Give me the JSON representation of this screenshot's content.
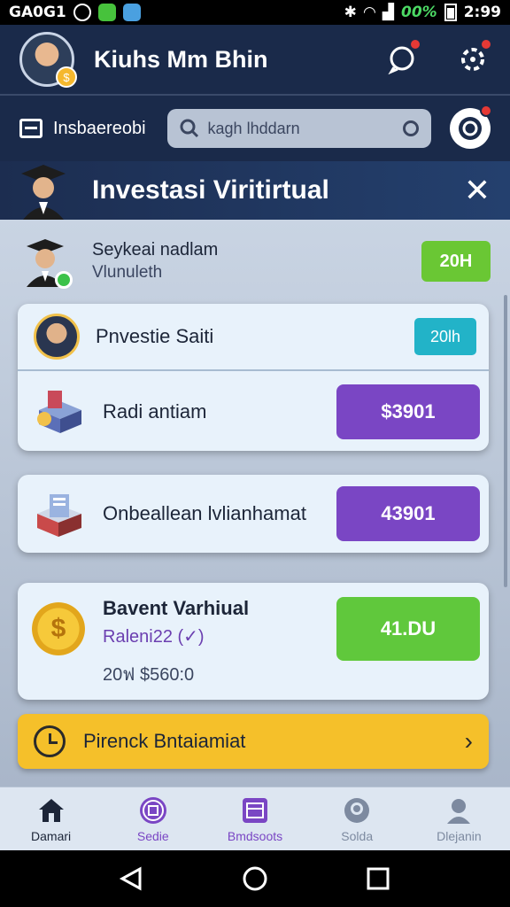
{
  "status_bar": {
    "carrier": "GA0G1",
    "battery": "00%",
    "time": "2:99"
  },
  "header": {
    "user_name": "Kiuhs Mm Bhin",
    "avatar_badge": "$"
  },
  "search_row": {
    "menu_label": "Insbaereobi",
    "search_placeholder": "kagh lhddarn"
  },
  "banner": {
    "title": "Investasi Viritirtual",
    "close": "✕"
  },
  "profile": {
    "name": "Seykeai nadlam",
    "subtitle": "Vlunuleth",
    "pill": "20H"
  },
  "card1": {
    "title": "Pnvestie Saiti",
    "pill": "20lh",
    "row_label": "Radi antiam",
    "button": "$3901"
  },
  "card2": {
    "row_label": "Onbeallean lvlianhamat",
    "button": "43901"
  },
  "card3": {
    "coin": "$",
    "title": "Bavent Varhiual",
    "subtitle": "Raleni22 (✓)",
    "amount": "20ฟ $560:0",
    "button": "41.DU"
  },
  "yellow_bar": {
    "label": "Pirenck Bntaiamiat",
    "chevron": "›"
  },
  "bottom_nav": [
    {
      "label": "Damari",
      "icon": "home-icon",
      "color": "#1c2538"
    },
    {
      "label": "Sedie",
      "icon": "photo-icon",
      "color": "#7a46c4"
    },
    {
      "label": "Bmdsoots",
      "icon": "grid-icon",
      "color": "#7a46c4"
    },
    {
      "label": "Solda",
      "icon": "globe-icon",
      "color": "#7d8aa0"
    },
    {
      "label": "Dlejanin",
      "icon": "profile-icon",
      "color": "#7d8aa0"
    }
  ],
  "colors": {
    "purple": "#7a46c4",
    "green": "#60c83c",
    "teal": "#22b3c8",
    "yellow": "#f5c02a",
    "navy": "#1a2a4a"
  }
}
